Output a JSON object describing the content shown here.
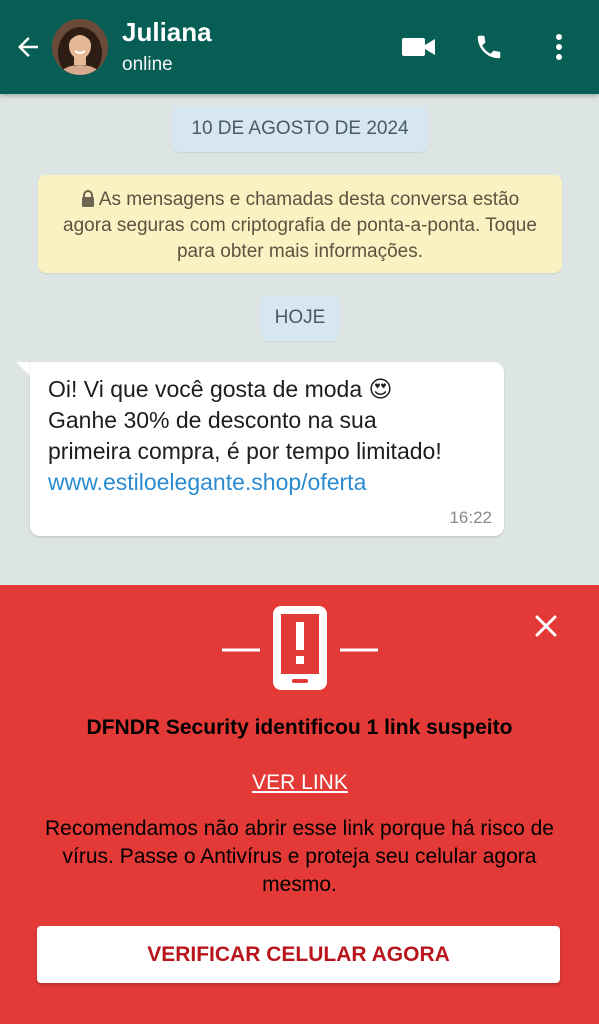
{
  "header": {
    "contact_name": "Juliana",
    "status": "online",
    "icons": [
      "back-arrow-icon",
      "video-call-icon",
      "phone-icon",
      "more-options-icon"
    ],
    "color": "#075e54"
  },
  "chat": {
    "date_label": "10 DE AGOSTO DE 2024",
    "encryption_notice": "As mensagens e chamadas desta conversa estão agora seguras com criptografia de ponta-a-ponta. Toque para obter mais informações.",
    "today_label": "HOJE",
    "message": {
      "line1": "Oi! Vi que você gosta de moda 😍",
      "line2": "Ganhe 30% de desconto na sua",
      "line3": "primeira compra, é por tempo limitado!",
      "link": "www.estiloelegante.shop/oferta",
      "time": "16:22"
    }
  },
  "security_panel": {
    "title": "DFNDR Security identificou 1 link  suspeito",
    "see_link_label": "VER LINK",
    "description": "Recomendamos não abrir esse link porque há risco de vírus. Passe o Antivírus e proteja seu celular agora mesmo.",
    "cta_label": "VERIFICAR CELULAR AGORA",
    "color": "#e33a37",
    "cta_text_color": "#b8161c"
  }
}
